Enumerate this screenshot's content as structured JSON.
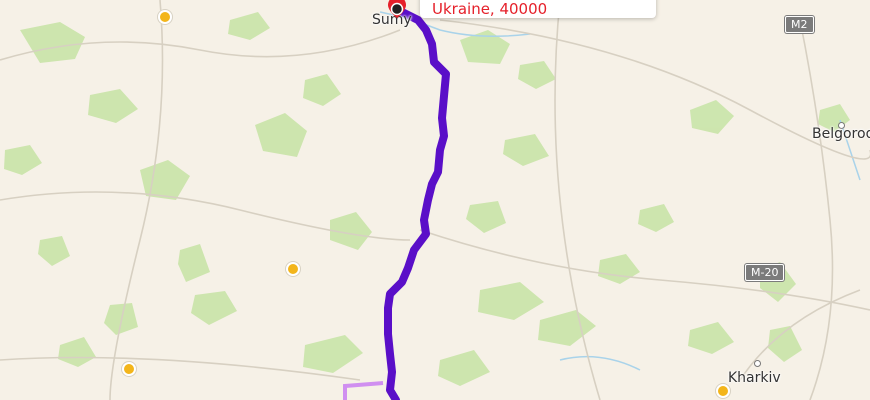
{
  "map": {
    "cities": [
      {
        "name": "Sumy"
      },
      {
        "name": "Belgorod"
      },
      {
        "name": "Kharkiv"
      }
    ],
    "road_shields": [
      {
        "label": "M2"
      },
      {
        "label": "M-20"
      }
    ],
    "popup": {
      "text": "Ukraine, 40000",
      "color": "#e5202a"
    },
    "route": {
      "color": "#5a0fc8",
      "alt_route_color": "#d08ff0"
    },
    "marker": {
      "icon": "map-pin-icon",
      "color": "#e5202a"
    },
    "poi_icon": "yellow-poi-dot-icon",
    "poi_color": "#f3b51b",
    "colors": {
      "land": "#f6f1e7",
      "forest": "#c9e4a8",
      "water": "#a9d3ea",
      "road": "#d7d0c2"
    }
  }
}
